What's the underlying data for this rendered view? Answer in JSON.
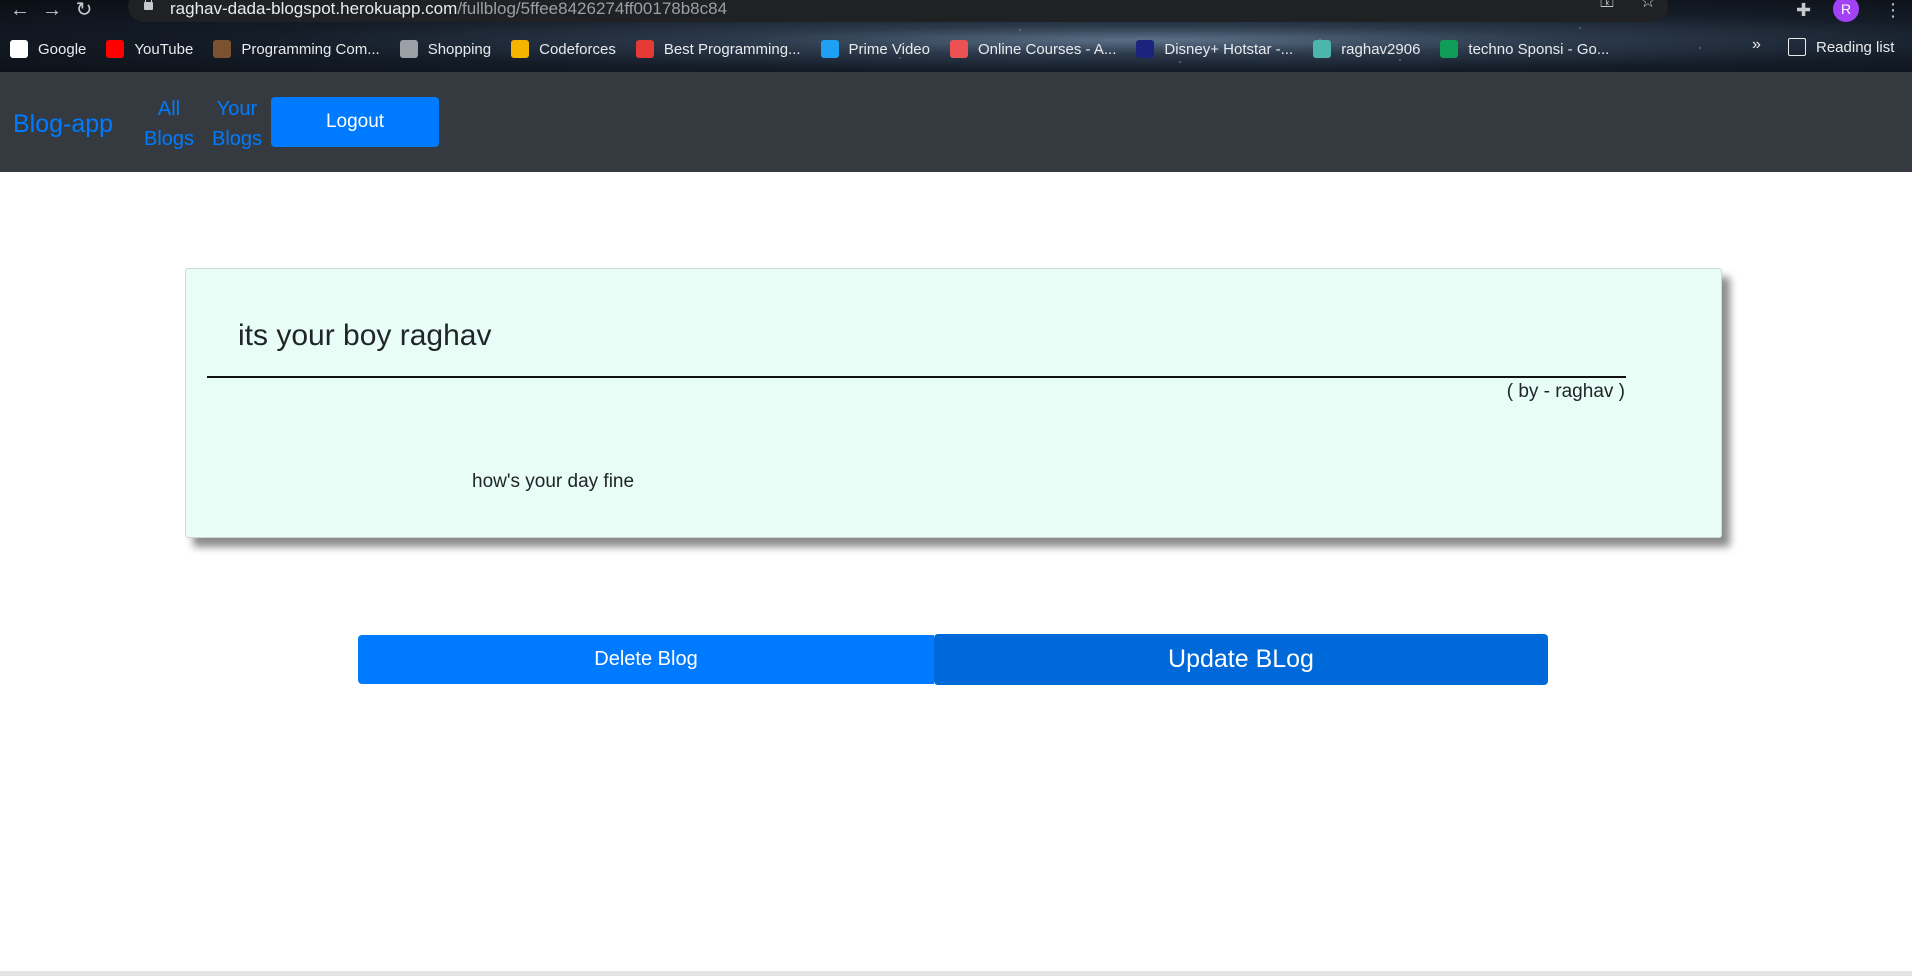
{
  "browser": {
    "url_host": "raghav-dada-blogspot.herokuapp.com",
    "url_path": "/fullblog/5ffee8426274ff00178b8c84",
    "profile_initial": "R",
    "bookmarks": [
      {
        "label": "Google",
        "icon": "google-icon",
        "color": "#ffffff"
      },
      {
        "label": "YouTube",
        "icon": "youtube-icon",
        "color": "#ff0000"
      },
      {
        "label": "Programming Com...",
        "icon": "cc-icon",
        "color": "#7a5230"
      },
      {
        "label": "Shopping",
        "icon": "globe-icon",
        "color": "#9aa0a6"
      },
      {
        "label": "Codeforces",
        "icon": "codeforces-icon",
        "color": "#f4b400"
      },
      {
        "label": "Best Programming...",
        "icon": "cube-icon",
        "color": "#e53935"
      },
      {
        "label": "Prime Video",
        "icon": "prime-video-icon",
        "color": "#1ea1f2"
      },
      {
        "label": "Online Courses - A...",
        "icon": "courses-icon",
        "color": "#ec5252"
      },
      {
        "label": "Disney+ Hotstar -...",
        "icon": "hotstar-icon",
        "color": "#1a237e"
      },
      {
        "label": "raghav2906",
        "icon": "profile-image-icon",
        "color": "#4db6ac"
      },
      {
        "label": "techno Sponsi - Go...",
        "icon": "sheets-icon",
        "color": "#0f9d58"
      }
    ],
    "more_label": "»",
    "reading_list_label": "Reading list"
  },
  "navbar": {
    "brand": "Blog-app",
    "all_blogs_line1": "All",
    "all_blogs_line2": "Blogs",
    "your_blogs_line1": "Your",
    "your_blogs_line2": "Blogs",
    "logout_label": "Logout"
  },
  "blog": {
    "title": "its your boy raghav",
    "author": "( by - raghav )",
    "body": "how's your day fine"
  },
  "actions": {
    "delete_label": "Delete Blog",
    "update_label": "Update BLog"
  },
  "colors": {
    "primary": "#007bff",
    "primary_dark": "#0069d9",
    "navbar_bg": "#343a40",
    "card_bg": "#e7fdf5"
  }
}
